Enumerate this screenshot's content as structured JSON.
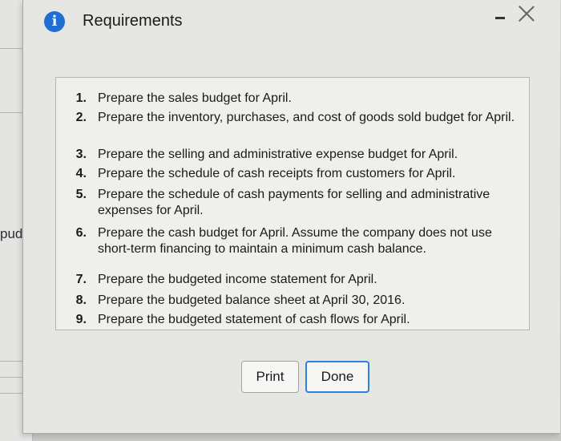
{
  "background": {
    "side_text": "pudg"
  },
  "dialog": {
    "title": "Requirements",
    "requirements": [
      {
        "num": "1.",
        "text": "Prepare the sales budget for April."
      },
      {
        "num": "2.",
        "text": "Prepare the inventory, purchases, and cost of goods sold budget for April."
      },
      {
        "num": "3.",
        "text": "Prepare the selling and administrative expense budget for April."
      },
      {
        "num": "4.",
        "text": "Prepare the schedule of cash receipts from customers for April."
      },
      {
        "num": "5.",
        "text": "Prepare the schedule of cash payments for selling and administrative expenses for April."
      },
      {
        "num": "6.",
        "text": "Prepare the cash budget for April. Assume the company does not use short-term financing to maintain a minimum cash balance."
      },
      {
        "num": "7.",
        "text": "Prepare the budgeted income statement for April."
      },
      {
        "num": "8.",
        "text": "Prepare the budgeted balance sheet at April 30, 2016."
      },
      {
        "num": "9.",
        "text": "Prepare the budgeted statement of cash flows for April."
      }
    ],
    "buttons": {
      "print": "Print",
      "done": "Done"
    }
  },
  "colors": {
    "info_icon": "#1f6fd1",
    "done_border": "#2d7fe0"
  }
}
